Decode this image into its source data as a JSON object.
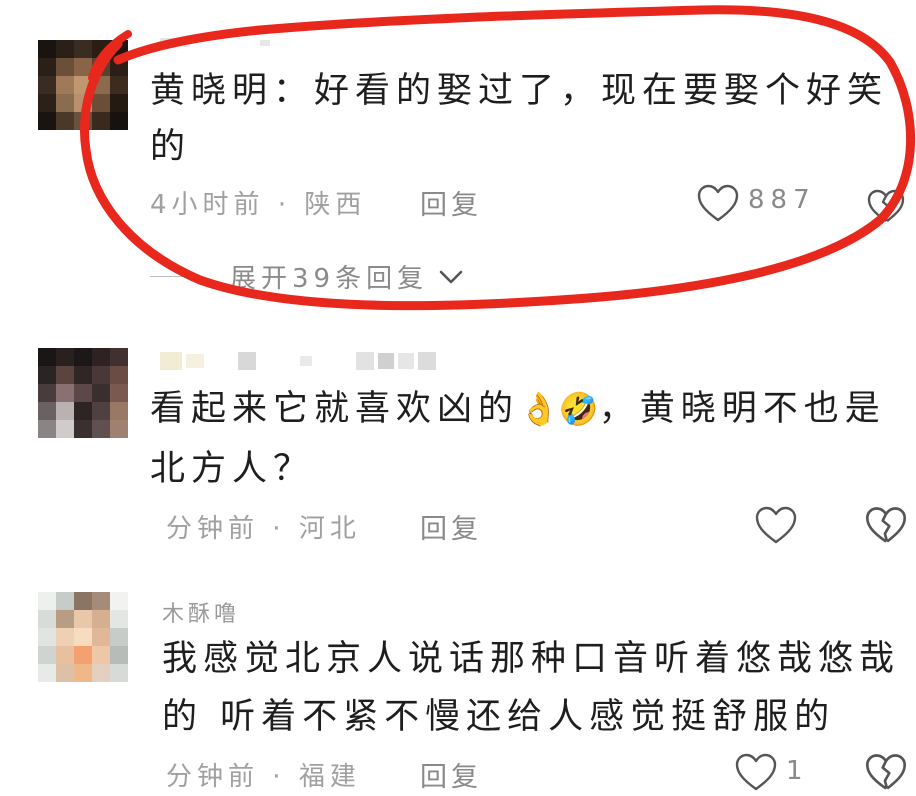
{
  "comments": [
    {
      "text_line1": "黄晓明：好看的娶过了，现在要娶个好笑",
      "text_line2": "的",
      "time": "4小时前",
      "location": "陕西",
      "reply_label": "回复",
      "likes": "887",
      "expand_label": "展开39条回复"
    },
    {
      "text_line1a": "看起来它就喜欢凶的",
      "emoji_ok": "👌",
      "emoji_rofl": "🤣",
      "text_line1b": "，黄晓明不也是",
      "text_line2": "北方人？",
      "time": "分钟前",
      "location": "河北",
      "reply_label": "回复"
    },
    {
      "username": "木酥噜",
      "text_line1": "我感觉北京人说话那种口音听着悠哉悠哉",
      "text_line2": "的 听着不紧不慢还给人感觉挺舒服的",
      "time": "分钟前",
      "location": "福建",
      "reply_label": "回复",
      "likes": "1"
    }
  ],
  "colors": {
    "annotation": "#e8271d",
    "meta_gray": "#a0a0a0",
    "icon_gray": "#555555"
  },
  "icons": [
    "heart-outline-icon",
    "broken-heart-icon",
    "chevron-down-icon"
  ]
}
